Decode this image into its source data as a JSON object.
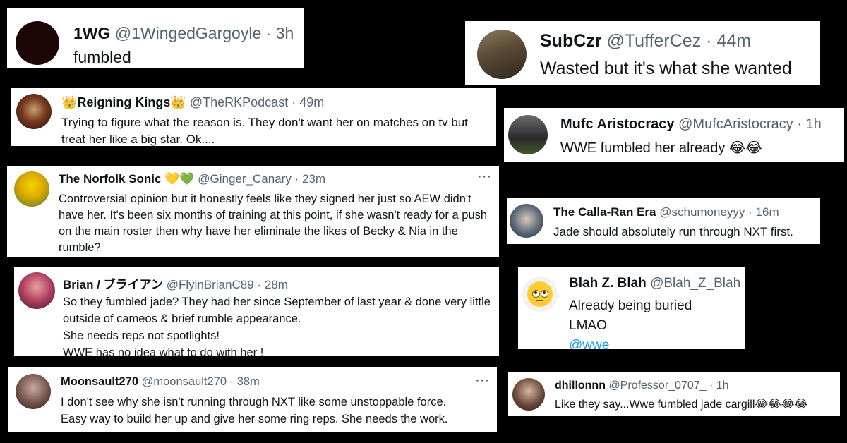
{
  "tweets": [
    {
      "name": "1WG",
      "handle": "@1WingedGargoyle",
      "sep": " · ",
      "time": "3h",
      "text": "fumbled"
    },
    {
      "name": "SubCzr",
      "handle": "@TufferCez",
      "sep": " · ",
      "time": "44m",
      "text": "Wasted but it's what she wanted"
    },
    {
      "name_prefix": "👑",
      "name": "Reigning Kings",
      "name_suffix": "👑",
      "handle": "@TheRKPodcast",
      "sep": " · ",
      "time": "49m",
      "text": "Trying to figure what the reason is. They don't want her on matches on tv but treat her like a big star. Ok...."
    },
    {
      "name": "Mufc Aristocracy",
      "handle": "@MufcAristocracy",
      "sep": " · ",
      "time": "1h",
      "text": "WWE fumbled her already 😂😂"
    },
    {
      "name": "The Norfolk Sonic",
      "name_suffix": "💛💚",
      "handle": "@Ginger_Canary",
      "sep": " · ",
      "time": "23m",
      "more": "···",
      "text": "Controversial opinion but it honestly feels like they signed her just so AEW didn't have her. It's been six months of training at this point, if she wasn't ready for a push on the main roster then why have her eliminate the likes of Becky & Nia in the rumble?"
    },
    {
      "name": "The Calla-Ran Era",
      "handle": "@schumoneyyy",
      "sep": " · ",
      "time": "16m",
      "text": "Jade should absolutely run through NXT first."
    },
    {
      "name": "Brian / ブライアン",
      "handle": "@FlyinBrianC89",
      "sep": " · ",
      "time": "28m",
      "lines": [
        "So they fumbled jade? They had her since September of last year & done very little outside of cameos & brief rumble appearance.",
        "She needs reps not spotlights!",
        "WWE has no idea what to do with her !"
      ]
    },
    {
      "name": "Blah Z. Blah",
      "handle": "@Blah_Z_Blah",
      "lines": [
        "Already being buried",
        "LMAO"
      ],
      "mention": "@wwe"
    },
    {
      "name": "Moonsault270",
      "handle": "@moonsault270",
      "sep": " · ",
      "time": "38m",
      "more": "···",
      "lines": [
        "I don't see why she isn't running through NXT like some unstoppable force.",
        "Easy way to build her up and give her some ring reps.  She needs the work."
      ]
    },
    {
      "name": "dhillonnn",
      "handle": "@Professor_0707_",
      "sep": " · ",
      "time": "1h",
      "text": "Like they say...Wwe fumbled jade cargill😂😂😂😂"
    }
  ],
  "colors": {
    "name": "#0f1419",
    "meta": "#536471",
    "link": "#1d9bf0",
    "card": "#ffffff",
    "bg": "#000000"
  }
}
